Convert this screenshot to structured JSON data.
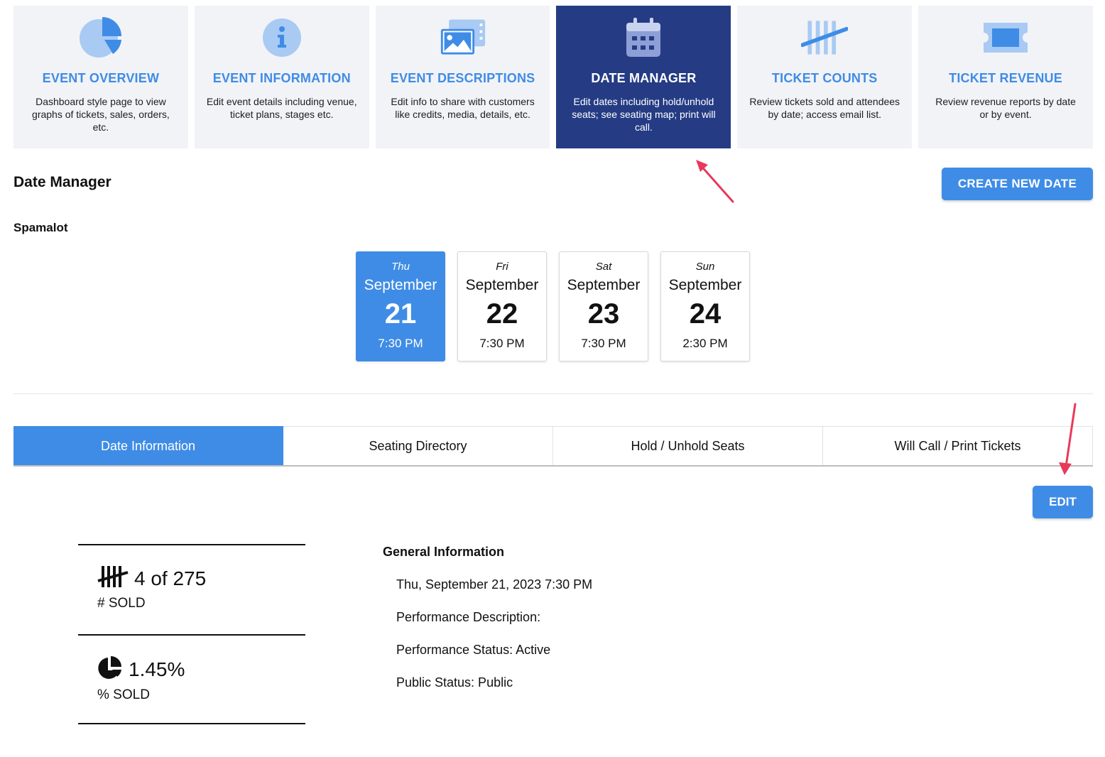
{
  "nav_cards": [
    {
      "title": "EVENT OVERVIEW",
      "desc": "Dashboard style page to view graphs of tickets, sales, orders, etc.",
      "icon": "pie-chart-icon",
      "active": false
    },
    {
      "title": "EVENT INFORMATION",
      "desc": "Edit event details including venue, ticket plans, stages etc.",
      "icon": "info-icon",
      "active": false
    },
    {
      "title": "EVENT DESCRIPTIONS",
      "desc": "Edit info to share with customers like credits, media, details, etc.",
      "icon": "images-icon",
      "active": false
    },
    {
      "title": "DATE MANAGER",
      "desc": "Edit dates including hold/unhold seats; see seating map; print will call.",
      "icon": "calendar-icon",
      "active": true
    },
    {
      "title": "TICKET COUNTS",
      "desc": "Review tickets sold and attendees by date; access email list.",
      "icon": "tally-icon",
      "active": false
    },
    {
      "title": "TICKET REVENUE",
      "desc": "Review revenue reports by date or by event.",
      "icon": "ticket-icon",
      "active": false
    }
  ],
  "header": {
    "title": "Date Manager",
    "create_button": "CREATE NEW DATE"
  },
  "event_name": "Spamalot",
  "dates": [
    {
      "dow": "Thu",
      "month": "September",
      "day": "21",
      "time": "7:30 PM",
      "active": true
    },
    {
      "dow": "Fri",
      "month": "September",
      "day": "22",
      "time": "7:30 PM",
      "active": false
    },
    {
      "dow": "Sat",
      "month": "September",
      "day": "23",
      "time": "7:30 PM",
      "active": false
    },
    {
      "dow": "Sun",
      "month": "September",
      "day": "24",
      "time": "2:30 PM",
      "active": false
    }
  ],
  "tabs": [
    {
      "label": "Date Information",
      "active": true
    },
    {
      "label": "Seating Directory",
      "active": false
    },
    {
      "label": "Hold / Unhold Seats",
      "active": false
    },
    {
      "label": "Will Call / Print Tickets",
      "active": false
    }
  ],
  "edit_button": "EDIT",
  "stats": {
    "sold": {
      "value": "4 of 275",
      "label": "# SOLD",
      "icon": "tally-icon"
    },
    "percent": {
      "value": "1.45%",
      "label": "% SOLD",
      "icon": "pie-chart-icon"
    }
  },
  "general_info": {
    "title": "General Information",
    "date_line": "Thu, September 21, 2023 7:30 PM",
    "description_line": "Performance Description:",
    "status_line": "Performance Status: Active",
    "public_line": "Public Status: Public"
  },
  "colors": {
    "accent": "#3f8ce6",
    "active_nav": "#253c84",
    "card_bg": "#f2f3f7",
    "arrow": "#e8395b"
  }
}
